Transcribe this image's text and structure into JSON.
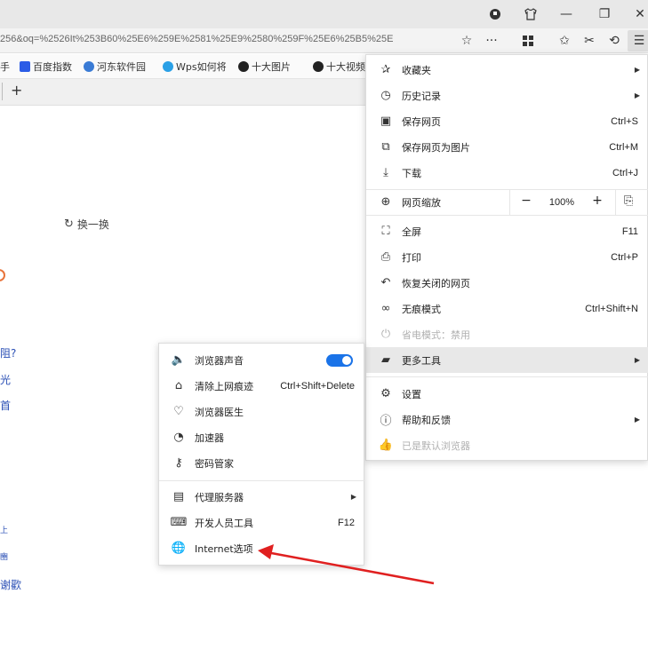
{
  "window": {
    "controls": {
      "minimize": "—",
      "maximize": "❐",
      "close": "✕"
    }
  },
  "address_bar": {
    "url": "256&oq=%2526It%253B60%25E6%259E%2581%25E9%2580%259F%25E6%25B5%25E"
  },
  "bookmarks": [
    {
      "label": "手"
    },
    {
      "label": "百度指数"
    },
    {
      "label": "河东软件园"
    },
    {
      "label": "Wps如何将"
    },
    {
      "label": "十大图片"
    },
    {
      "label": "十大视频"
    }
  ],
  "tabs": {
    "new_tab": "+"
  },
  "page": {
    "refresh_label": "换一换",
    "left_text": [
      "阻?",
      "光",
      "首",
      "上",
      "豳",
      "谢歡"
    ]
  },
  "main_menu": {
    "items": [
      {
        "label": "收藏夹",
        "shortcut": "",
        "submenu": true,
        "icon": "star-list-icon"
      },
      {
        "label": "历史记录",
        "shortcut": "",
        "submenu": true,
        "icon": "clock-icon"
      },
      {
        "label": "保存网页",
        "shortcut": "Ctrl+S",
        "submenu": false,
        "icon": "save-page-icon"
      },
      {
        "label": "保存网页为图片",
        "shortcut": "Ctrl+M",
        "submenu": false,
        "icon": "image-save-icon"
      },
      {
        "label": "下载",
        "shortcut": "Ctrl+J",
        "submenu": false,
        "icon": "download-icon"
      }
    ],
    "zoom": {
      "label": "网页缩放",
      "minus": "−",
      "value": "100%",
      "plus": "+"
    },
    "items2": [
      {
        "label": "全屏",
        "shortcut": "F11",
        "icon": "fullscreen-icon"
      },
      {
        "label": "打印",
        "shortcut": "Ctrl+P",
        "icon": "print-icon"
      },
      {
        "label": "恢复关闭的网页",
        "shortcut": "",
        "icon": "restore-icon"
      },
      {
        "label": "无痕模式",
        "shortcut": "Ctrl+Shift+N",
        "icon": "incognito-icon"
      },
      {
        "label": "省电模式：禁用",
        "shortcut": "",
        "icon": "power-save-icon"
      },
      {
        "label": "更多工具",
        "shortcut": "",
        "icon": "toolbox-icon"
      }
    ],
    "items3": [
      {
        "label": "设置",
        "icon": "gear-icon"
      },
      {
        "label": "帮助和反馈",
        "icon": "help-icon"
      },
      {
        "label": "已是默认浏览器",
        "icon": "thumbs-up-icon"
      }
    ]
  },
  "sub_menu": {
    "items": [
      {
        "label": "浏览器声音",
        "shortcut": "",
        "icon": "speaker-icon",
        "toggle": true
      },
      {
        "label": "清除上网痕迹",
        "shortcut": "Ctrl+Shift+Delete",
        "icon": "broom-icon"
      },
      {
        "label": "浏览器医生",
        "shortcut": "",
        "icon": "doctor-icon"
      },
      {
        "label": "加速器",
        "shortcut": "",
        "icon": "speedometer-icon"
      },
      {
        "label": "密码管家",
        "shortcut": "",
        "icon": "key-icon"
      }
    ],
    "items2": [
      {
        "label": "代理服务器",
        "shortcut": "",
        "icon": "proxy-icon",
        "submenu": true
      },
      {
        "label": "开发人员工具",
        "shortcut": "F12",
        "icon": "devtools-icon"
      },
      {
        "label": "Internet选项",
        "shortcut": "",
        "icon": "globe-icon"
      }
    ]
  },
  "colors": {
    "accent": "#1a73e8",
    "arrow": "#e02020",
    "link": "#2a4fb5"
  }
}
